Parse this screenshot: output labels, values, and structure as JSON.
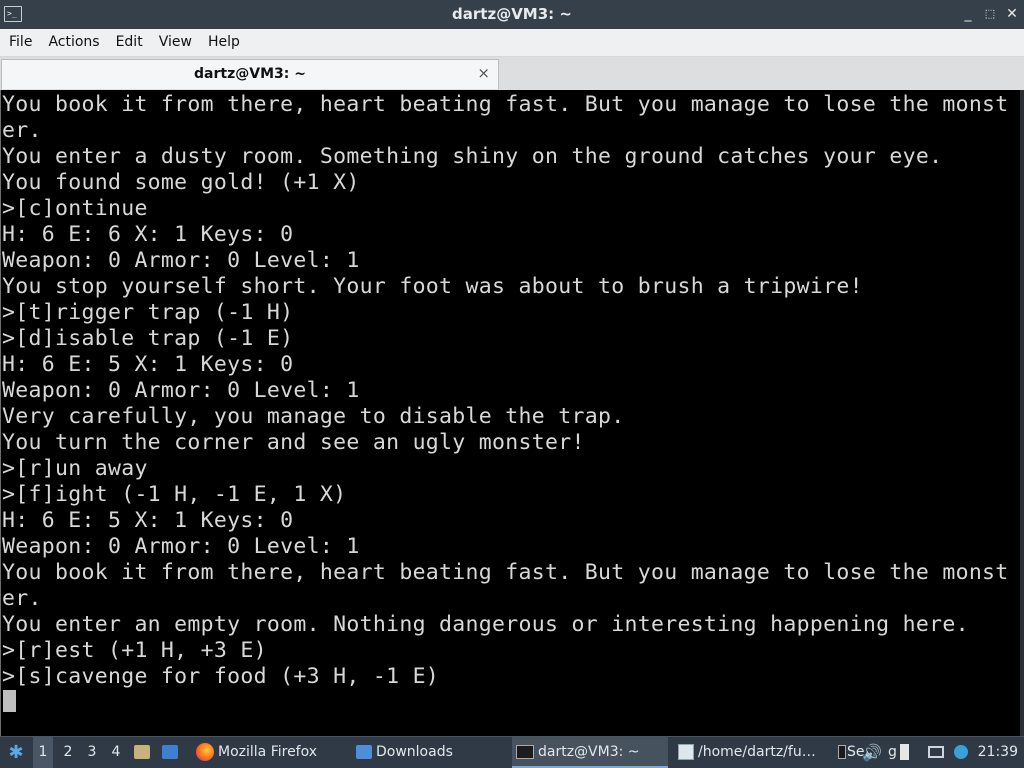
{
  "window": {
    "title": "dartz@VM3: ~",
    "controls": {
      "minimize": "_",
      "restore": "⬚",
      "close": "✕"
    }
  },
  "menu": [
    "File",
    "Actions",
    "Edit",
    "View",
    "Help"
  ],
  "tab": {
    "label": "dartz@VM3: ~",
    "close": "×"
  },
  "terminal": {
    "lines": [
      "You book it from there, heart beating fast. But you manage to lose the monst",
      "er.",
      "You enter a dusty room. Something shiny on the ground catches your eye.",
      "You found some gold! (+1 X)",
      ">[c]ontinue",
      "H: 6 E: 6 X: 1 Keys: 0",
      "Weapon: 0 Armor: 0 Level: 1",
      "You stop yourself short. Your foot was about to brush a tripwire!",
      ">[t]rigger trap (-1 H)",
      ">[d]isable trap (-1 E)",
      "H: 6 E: 5 X: 1 Keys: 0",
      "Weapon: 0 Armor: 0 Level: 1",
      "Very carefully, you manage to disable the trap.",
      "You turn the corner and see an ugly monster!",
      ">[r]un away",
      ">[f]ight (-1 H, -1 E, 1 X)",
      "H: 6 E: 5 X: 1 Keys: 0",
      "Weapon: 0 Armor: 0 Level: 1",
      "You book it from there, heart beating fast. But you manage to lose the monst",
      "er.",
      "You enter an empty room. Nothing dangerous or interesting happening here.",
      ">[r]est (+1 H, +3 E)",
      ">[s]cavenge for food (+3 H, -1 E)"
    ]
  },
  "taskbar": {
    "workspaces": [
      "1",
      "2",
      "3",
      "4"
    ],
    "active_workspace": "1",
    "tasks": [
      {
        "label": "Mozilla Firefox",
        "icon": "firefox-icon"
      },
      {
        "label": "Downloads",
        "icon": "folder-icon"
      },
      {
        "label": "dartz@VM3: ~",
        "icon": "terminal-icon"
      },
      {
        "label": "/home/dartz/fu…",
        "icon": "text-editor-icon"
      },
      {
        "label": "Se",
        "icon": "terminal-icon"
      },
      {
        "label": "g",
        "icon": "app-icon"
      }
    ],
    "clock": "21:39"
  },
  "colors": {
    "titlebar": "#36404a",
    "menubar": "#eff0f1",
    "terminal_bg": "#000000",
    "terminal_fg": "#d8d8d8",
    "taskbar": "#2f3a46"
  }
}
